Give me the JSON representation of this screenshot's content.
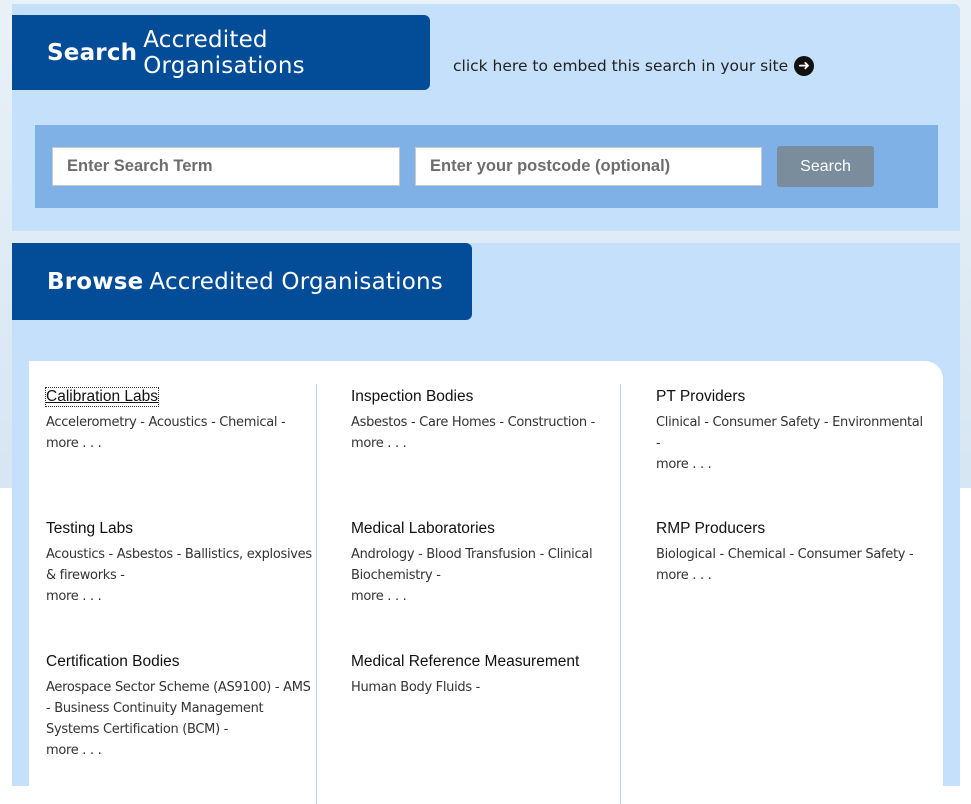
{
  "search": {
    "heading_bold": "Search",
    "heading_rest": "Accredited Organisations",
    "embed_text": "click here to embed this search in your site",
    "term_placeholder": "Enter Search Term",
    "postcode_placeholder": "Enter your postcode (optional)",
    "button_label": "Search"
  },
  "browse": {
    "heading_bold": "Browse",
    "heading_rest": "Accredited Organisations",
    "more_label": "more . . .",
    "categories": [
      {
        "title": "Calibration Labs",
        "items": "Accelerometry - Acoustics - Chemical -"
      },
      {
        "title": "Inspection Bodies",
        "items": "Asbestos - Care Homes - Construction -"
      },
      {
        "title": "PT Providers",
        "items": "Clinical - Consumer Safety - Environmental -"
      },
      {
        "title": "Testing Labs",
        "items": "Acoustics - Asbestos - Ballistics, explosives & fireworks -"
      },
      {
        "title": "Medical Laboratories",
        "items": "Andrology - Blood Transfusion - Clinical Biochemistry -"
      },
      {
        "title": "RMP Producers",
        "items": "Biological - Chemical - Consumer Safety -"
      },
      {
        "title": "Certification Bodies",
        "items": "Aerospace Sector Scheme (AS9100) - AMS - Business Continuity Management Systems Certification (BCM) -"
      },
      {
        "title": "Medical Reference Measurement",
        "items": "Human Body Fluids -"
      }
    ]
  }
}
